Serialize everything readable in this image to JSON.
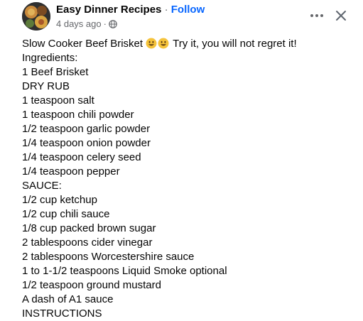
{
  "page": {
    "author_name": "Easy Dinner Recipes",
    "separator": " · ",
    "follow_label": "Follow",
    "timestamp": "4 days ago",
    "meta_dot": "·",
    "privacy_icon": "globe-icon"
  },
  "actions": {
    "more_icon": "more-horizontal-icon",
    "close_icon": "close-icon"
  },
  "post": {
    "title_text": "Slow Cooker Beef Brisket",
    "title_emojis": [
      "grinning-face-emoji",
      "grinning-face-emoji"
    ],
    "title_tail": " Try it, you will not regret it!",
    "lines": [
      "Ingredients:",
      "1 Beef Brisket",
      "DRY RUB",
      "1 teaspoon salt",
      "1 teaspoon chili powder",
      "1/2 teaspoon garlic powder",
      "1/4 teaspoon onion powder",
      "1/4 teaspoon celery seed",
      "1/4 teaspoon pepper",
      "SAUCE:",
      "1/2 cup ketchup",
      "1/2 cup chili sauce",
      "1/8 cup packed brown sugar",
      "2 tablespoons cider vinegar",
      "2 tablespoons Worcestershire sauce",
      "1 to 1-1/2 teaspoons Liquid Smoke optional",
      "1/2 teaspoon ground mustard",
      "A dash of A1 sauce",
      "INSTRUCTIONS"
    ]
  },
  "colors": {
    "text": "#050505",
    "secondary_text": "#65676b",
    "link": "#0866ff",
    "emoji_face": "#f5c33b"
  }
}
